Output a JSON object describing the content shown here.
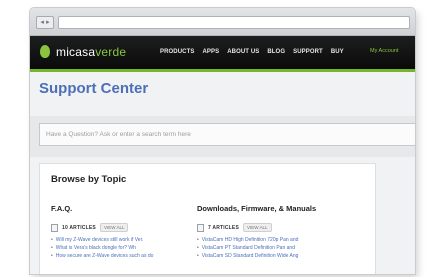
{
  "browser": {
    "back_glyph": "◂ ▸"
  },
  "nav": {
    "logo_prefix": "micasa",
    "logo_suffix": "verde",
    "items": [
      "PRODUCTS",
      "APPS",
      "ABOUT US",
      "BLOG",
      "SUPPORT",
      "BUY"
    ],
    "account_label": "My Account"
  },
  "page": {
    "title": "Support Center",
    "search_placeholder": "Have a Question? Ask or enter a search term here"
  },
  "browse": {
    "title": "Browse by Topic",
    "faq": {
      "title": "F.A.Q.",
      "count": "10 ARTICLES",
      "view_all": "VIEW ALL",
      "items": [
        "Will my Z-Wave devices still work if Ver.",
        "What is Vera's black dongle for? Wh",
        "How secure are Z-Wave devices such as do"
      ]
    },
    "downloads": {
      "title": "Downloads, Firmware, & Manuals",
      "count": "7 ARTICLES",
      "view_all": "VIEW ALL",
      "items": [
        "VistaCam HD High Definition 720p Pan and",
        "VistaCam PT Standard Definition Pan and",
        "VistaCam SD Standard Definition Wide Ang"
      ]
    }
  }
}
